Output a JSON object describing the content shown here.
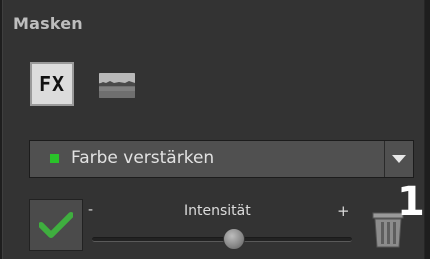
{
  "panel": {
    "title": "Masken"
  },
  "mask_mode_buttons": [
    {
      "label": "FX",
      "icon": "fx-icon"
    },
    {
      "icon": "landscape-thumbnail-icon"
    }
  ],
  "dropdown": {
    "selected_value": "Farbe verstärken",
    "indicator_color": "#29c229",
    "arrow_icon": "chevron-down-icon"
  },
  "apply_button": {
    "icon": "checkmark-icon",
    "accent": "#3fae3f"
  },
  "intensity": {
    "label": "Intensität",
    "minus_label": "-",
    "plus_label": "+",
    "value_fraction": 0.55
  },
  "delete_button": {
    "icon": "trash-icon"
  },
  "annotation_badge": {
    "label": "1"
  }
}
